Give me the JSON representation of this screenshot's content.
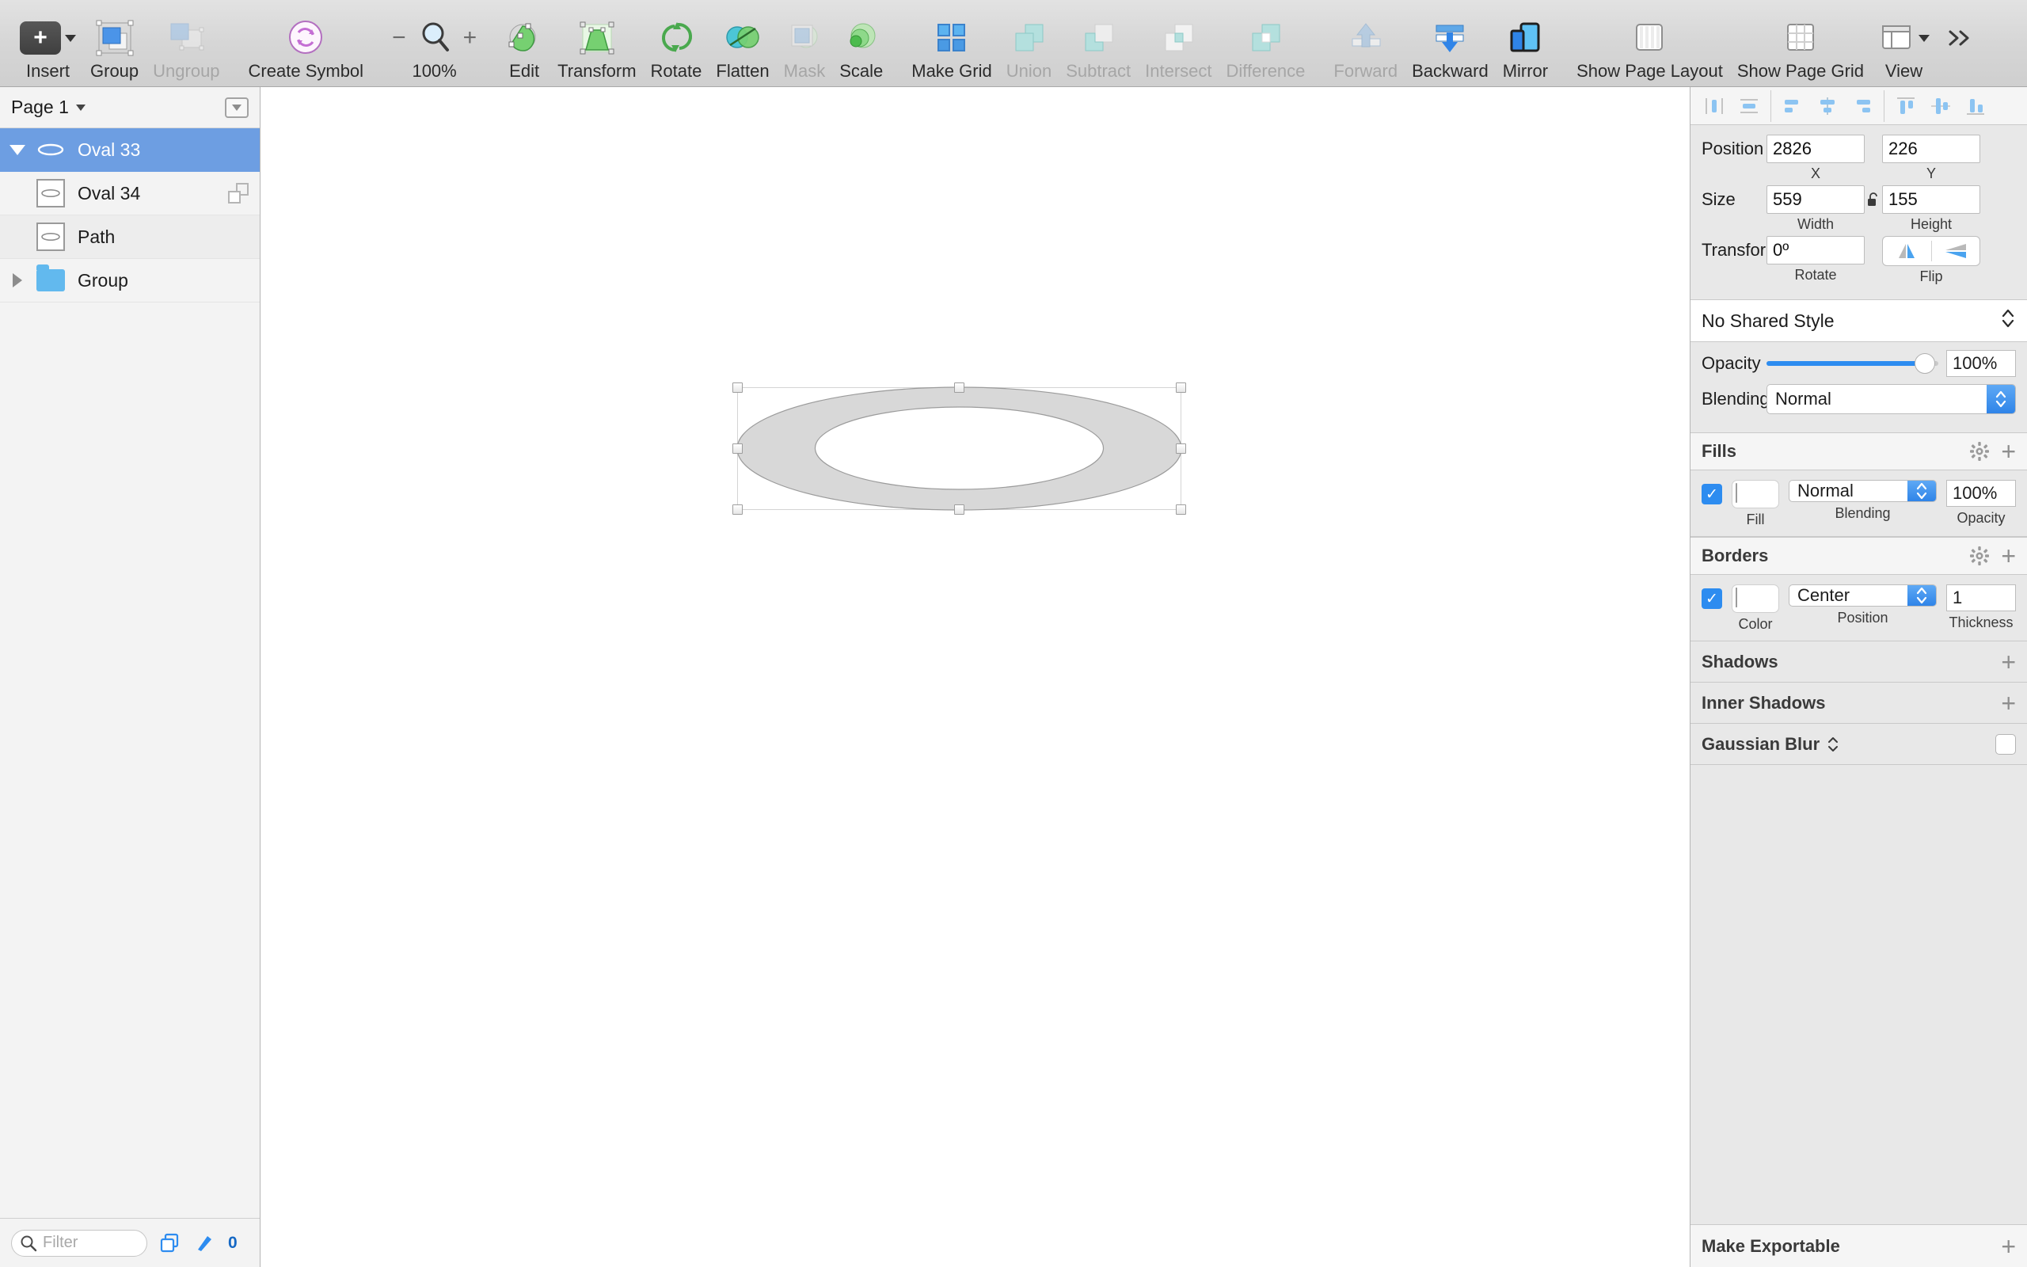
{
  "toolbar": {
    "items": [
      {
        "label": "Insert",
        "icon": "insert-plus-icon",
        "enabled": true
      },
      {
        "label": "Group",
        "icon": "group-icon",
        "enabled": true
      },
      {
        "label": "Ungroup",
        "icon": "ungroup-icon",
        "enabled": false
      },
      {
        "label": "Create Symbol",
        "icon": "create-symbol-icon",
        "enabled": true
      },
      {
        "label": "100%",
        "icon": "zoom-magnifier-icon",
        "enabled": true
      },
      {
        "label": "Edit",
        "icon": "edit-icon",
        "enabled": true
      },
      {
        "label": "Transform",
        "icon": "transform-icon",
        "enabled": true
      },
      {
        "label": "Rotate",
        "icon": "rotate-icon",
        "enabled": true
      },
      {
        "label": "Flatten",
        "icon": "flatten-icon",
        "enabled": true
      },
      {
        "label": "Mask",
        "icon": "mask-icon",
        "enabled": false
      },
      {
        "label": "Scale",
        "icon": "scale-icon",
        "enabled": true
      },
      {
        "label": "Make Grid",
        "icon": "make-grid-icon",
        "enabled": true
      },
      {
        "label": "Union",
        "icon": "union-icon",
        "enabled": false
      },
      {
        "label": "Subtract",
        "icon": "subtract-icon",
        "enabled": false
      },
      {
        "label": "Intersect",
        "icon": "intersect-icon",
        "enabled": false
      },
      {
        "label": "Difference",
        "icon": "difference-icon",
        "enabled": false
      },
      {
        "label": "Forward",
        "icon": "forward-icon",
        "enabled": false
      },
      {
        "label": "Backward",
        "icon": "backward-icon",
        "enabled": true
      },
      {
        "label": "Mirror",
        "icon": "mirror-icon",
        "enabled": true
      },
      {
        "label": "Show Page Layout",
        "icon": "page-layout-icon",
        "enabled": true
      },
      {
        "label": "Show Page Grid",
        "icon": "page-grid-icon",
        "enabled": true
      },
      {
        "label": "View",
        "icon": "view-icon",
        "enabled": true
      }
    ],
    "zoom_minus": "−",
    "zoom_plus": "+",
    "overflow": "»"
  },
  "sidebar": {
    "page_name": "Page 1",
    "layers": [
      {
        "name": "Oval 33",
        "type": "oval",
        "selected": true,
        "expanded": true,
        "depth": 0
      },
      {
        "name": "Oval 34",
        "type": "oval-thumb",
        "selected": false,
        "depth": 1,
        "badge": "duplicate-icon"
      },
      {
        "name": "Path",
        "type": "oval-thumb",
        "selected": false,
        "depth": 1
      },
      {
        "name": "Group",
        "type": "folder",
        "selected": false,
        "expanded": false,
        "depth": 0
      }
    ],
    "filter_placeholder": "Filter",
    "slice_count": "0"
  },
  "inspector": {
    "align": [
      "align-left-icon",
      "align-center-horizontal-icon",
      "distribute-left-icon",
      "distribute-center-icon",
      "distribute-right-icon",
      "align-top-icon",
      "align-middle-icon",
      "align-bottom-icon"
    ],
    "geometry": {
      "position_label": "Position",
      "x_value": "2826",
      "x_caption": "X",
      "y_value": "226",
      "y_caption": "Y",
      "size_label": "Size",
      "width_value": "559",
      "width_caption": "Width",
      "height_value": "155",
      "height_caption": "Height",
      "transform_label": "Transform",
      "rotate_value": "0º",
      "rotate_caption": "Rotate",
      "flip_caption": "Flip",
      "lock_icon": "unlocked-padlock-icon"
    },
    "shared_style": "No Shared Style",
    "opacity_label": "Opacity",
    "opacity_value": "100%",
    "blending_label": "Blending",
    "blending_value": "Normal",
    "fills": {
      "title": "Fills",
      "blending_value": "Normal",
      "opacity_value": "100%",
      "fill_caption": "Fill",
      "blending_caption": "Blending",
      "opacity_caption": "Opacity",
      "swatch_color": "#d2d2d2",
      "checked": true
    },
    "borders": {
      "title": "Borders",
      "position_value": "Center",
      "thickness_value": "1",
      "color_caption": "Color",
      "position_caption": "Position",
      "thickness_caption": "Thickness",
      "swatch_color": "#7c7c7c",
      "checked": true
    },
    "shadows_title": "Shadows",
    "inner_shadows_title": "Inner Shadows",
    "gaussian_blur_title": "Gaussian Blur",
    "make_exportable_title": "Make Exportable",
    "plus_glyph": "+",
    "accent_color": "#2d8cf0"
  },
  "canvas": {
    "shape_name": "oval-ring-shape",
    "fill_color": "#d8d8d8",
    "stroke_color": "#9b9b9b",
    "selection_handles": 8
  }
}
